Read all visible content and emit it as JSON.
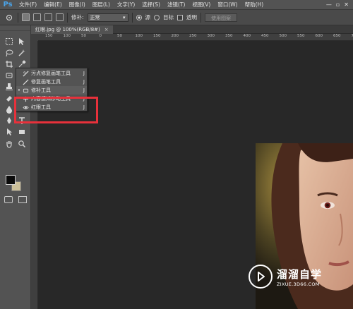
{
  "app": {
    "logo": "Ps"
  },
  "menubar": {
    "items": [
      "文件(F)",
      "编辑(E)",
      "图像(I)",
      "图层(L)",
      "文字(Y)",
      "选择(S)",
      "滤镜(T)",
      "视图(V)",
      "窗口(W)",
      "帮助(H)"
    ],
    "window_controls": [
      "—",
      "▫",
      "✕"
    ]
  },
  "options": {
    "sample_label": "修补:",
    "sample_value": "正常",
    "source_label": "源",
    "target_label": "目标",
    "transparent_label": "透明",
    "use_pattern_label": "使用图案",
    "source_selected": true
  },
  "document": {
    "tab_title": "红眼.jpg @ 100%(RGB/8#)",
    "tab_close": "×"
  },
  "ruler": {
    "top_ticks": [
      "150",
      "100",
      "50",
      "0",
      "50",
      "100",
      "150",
      "200",
      "250",
      "300",
      "350",
      "400",
      "450",
      "500",
      "550",
      "600",
      "650",
      "700",
      "750",
      "800"
    ]
  },
  "tool_flyout": {
    "items": [
      {
        "label": "污点修复画笔工具",
        "shortcut": "J",
        "icon": "spot-healing-brush-icon",
        "active": false
      },
      {
        "label": "修复画笔工具",
        "shortcut": "J",
        "icon": "healing-brush-icon",
        "active": false
      },
      {
        "label": "修补工具",
        "shortcut": "J",
        "icon": "patch-icon",
        "active": true
      },
      {
        "label": "内容感知移动工具",
        "shortcut": "J",
        "icon": "content-aware-move-icon",
        "active": false
      },
      {
        "label": "红眼工具",
        "shortcut": "J",
        "icon": "red-eye-icon",
        "active": false
      }
    ]
  },
  "watermark": {
    "title": "溜溜自学",
    "url": "ZIXUE.3D66.COM"
  },
  "colors": {
    "highlight": "#e7313b",
    "ps_blue": "#4aa3e8",
    "foreground": "#0a0a0a",
    "background": "#cbbf99"
  }
}
